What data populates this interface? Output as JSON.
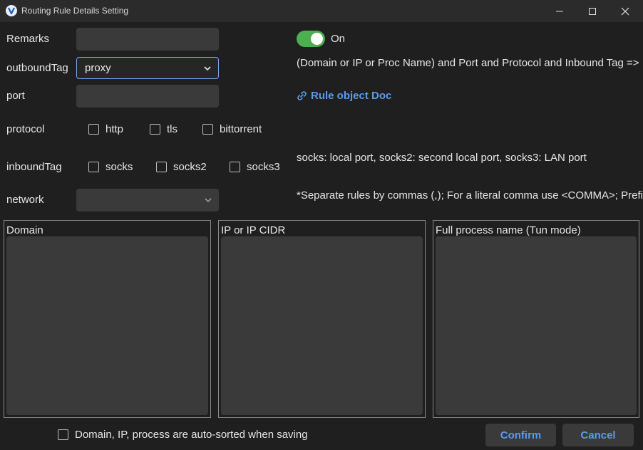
{
  "window": {
    "title": "Routing Rule Details Setting",
    "app_icon": "v2rayn-logo-icon",
    "controls": [
      "minimize-icon",
      "maximize-icon",
      "close-icon"
    ]
  },
  "form": {
    "remarks_label": "Remarks",
    "remarks_value": "",
    "outbound_label": "outboundTag",
    "outbound_value": "proxy",
    "port_label": "port",
    "port_value": "",
    "protocol_label": "protocol",
    "protocols": [
      {
        "label": "http",
        "checked": false
      },
      {
        "label": "tls",
        "checked": false
      },
      {
        "label": "bittorrent",
        "checked": false
      }
    ],
    "inbound_label": "inboundTag",
    "inbounds": [
      {
        "label": "socks",
        "checked": false
      },
      {
        "label": "socks2",
        "checked": false
      },
      {
        "label": "socks3",
        "checked": false
      }
    ],
    "network_label": "network",
    "network_value": ""
  },
  "right": {
    "toggle_on": true,
    "toggle_label": "On",
    "match_info": "(Domain or IP or Proc Name) and Port and Protocol and Inbound Tag =>",
    "doc_link": "Rule object Doc",
    "inbound_tip": "socks: local port, socks2: second local port, socks3: LAN port",
    "separator_tip": "*Separate rules by commas (,); For a literal comma use <COMMA>; Prefix"
  },
  "panels": {
    "domain": "Domain",
    "ip": "IP or IP CIDR",
    "process": "Full process name (Tun mode)"
  },
  "footer": {
    "autosort_label": "Domain, IP, process are auto-sorted when saving",
    "autosort_checked": false,
    "confirm": "Confirm",
    "cancel": "Cancel"
  },
  "colors": {
    "accent": "#5a9bea",
    "toggle_on": "#4caf50",
    "select_border": "#7aa7e8"
  }
}
